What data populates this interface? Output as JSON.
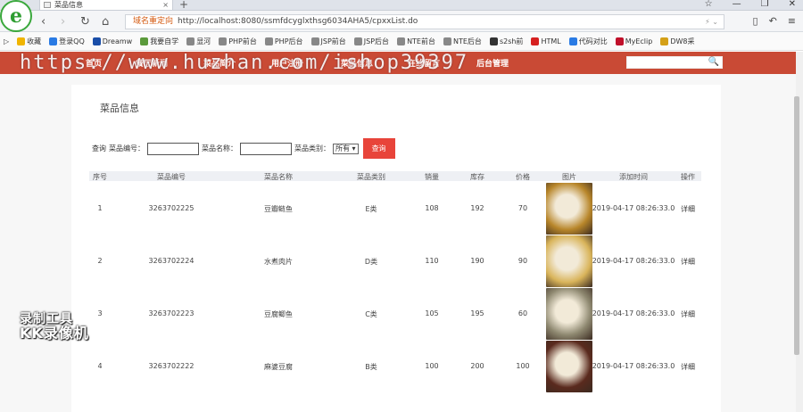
{
  "browser": {
    "tab_title": "菜品信息",
    "tab_close": "×",
    "new_tab": "+",
    "window_buttons": [
      "☆",
      "—",
      "❐",
      "✕"
    ],
    "nav_buttons": [
      "‹",
      "›",
      "↻",
      "⌂"
    ],
    "url_prefix": "域名重定向",
    "url": "http://localhost:8080/ssmfdcyglxthsg6034AHA5/cpxxList.do",
    "url_suffix": "⚡ ⌄",
    "right_buttons": [
      "▯",
      "↶",
      "≡"
    ],
    "bookmarks": [
      {
        "label": "收藏",
        "color": "#f0b400"
      },
      {
        "label": "登录QQ",
        "color": "#2a7be4"
      },
      {
        "label": "Dreamw",
        "color": "#1a4ea8"
      },
      {
        "label": "我要自学",
        "color": "#5b9a3b"
      },
      {
        "label": "显河",
        "color": "#888888"
      },
      {
        "label": "PHP前台",
        "color": "#888888"
      },
      {
        "label": "PHP后台",
        "color": "#888888"
      },
      {
        "label": "JSP前台",
        "color": "#888888"
      },
      {
        "label": "JSP后台",
        "color": "#888888"
      },
      {
        "label": "NTE前台",
        "color": "#888888"
      },
      {
        "label": "NTE后台",
        "color": "#888888"
      },
      {
        "label": "s2sh前",
        "color": "#333333"
      },
      {
        "label": "HTML",
        "color": "#d62020"
      },
      {
        "label": "代码对比",
        "color": "#2a7be4"
      },
      {
        "label": "MyEclip",
        "color": "#c0102a"
      },
      {
        "label": "DW8采",
        "color": "#d4a017"
      }
    ]
  },
  "site": {
    "nav_items": [
      "首页",
      "餐厅新闻",
      "菜品简介",
      "用户注册",
      "菜品信息",
      "在线留言",
      "后台管理"
    ],
    "search_placeholder": "",
    "search_icon": "🔍",
    "watermark": "https://www.huzhan.com/ishop39397",
    "page_title": "菜品信息",
    "query": {
      "label_query": "查询",
      "label_code": "菜品编号：",
      "label_name": "菜品名称：",
      "label_category": "菜品类别：",
      "category_selected": "所有 ▾",
      "button": "查询"
    },
    "table": {
      "headers": [
        "序号",
        "菜品编号",
        "菜品名称",
        "菜品类别",
        "销量",
        "库存",
        "价格",
        "图片",
        "添加时间",
        "操作"
      ],
      "rows": [
        {
          "no": "1",
          "code": "3263702225",
          "name": "豆瓣鲢鱼",
          "category": "E类",
          "sales": "108",
          "stock": "192",
          "price": "70",
          "added": "2019-04-17 08:26:33.0",
          "action": "详细",
          "thumb_color": "#b8862a"
        },
        {
          "no": "2",
          "code": "3263702224",
          "name": "水煮肉片",
          "category": "D类",
          "sales": "110",
          "stock": "190",
          "price": "90",
          "added": "2019-04-17 08:26:33.0",
          "action": "详细",
          "thumb_color": "#d9b45a"
        },
        {
          "no": "3",
          "code": "3263702223",
          "name": "豆腐鲫鱼",
          "category": "C类",
          "sales": "105",
          "stock": "195",
          "price": "60",
          "added": "2019-04-17 08:26:33.0",
          "action": "详细",
          "thumb_color": "#8e8870"
        },
        {
          "no": "4",
          "code": "3263702222",
          "name": "麻婆豆腐",
          "category": "B类",
          "sales": "100",
          "stock": "200",
          "price": "100",
          "added": "2019-04-17 08:26:33.0",
          "action": "详细",
          "thumb_color": "#5a2a1e"
        }
      ]
    },
    "recorder_line1": "录制工具",
    "recorder_line2": "KK录像机"
  }
}
